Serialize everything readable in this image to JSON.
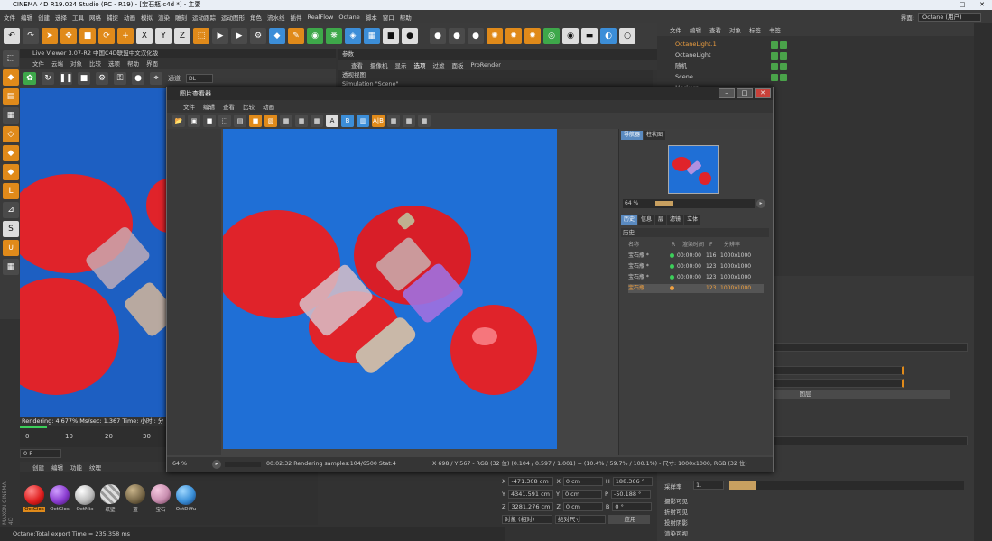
{
  "window": {
    "title": "CINEMA 4D R19.024 Studio (RC - R19) - [宝石瓶.c4d *] - 主要"
  },
  "menu": {
    "items": [
      "文件",
      "编辑",
      "创建",
      "选择",
      "工具",
      "网格",
      "捕捉",
      "动画",
      "模拟",
      "渲染",
      "雕刻",
      "运动跟踪",
      "运动图形",
      "角色",
      "流水线",
      "插件",
      "RealFlow",
      "Octane",
      "脚本",
      "窗口",
      "帮助"
    ],
    "layout_label": "界面:",
    "layout_value": "Octane (用户)"
  },
  "viewer": {
    "title": "Live Viewer 3.07-R2 中国C4D联盟中文汉化版",
    "menu": [
      "文件",
      "云端",
      "对象",
      "比较",
      "选项",
      "帮助",
      "界面"
    ],
    "channel_label": "通道",
    "channel_value": "DL",
    "status": "Rendering: 4.677% Ms/sec: 1.367   Time: 小时 : 分钟 : 秒/..."
  },
  "timeline": {
    "ticks": [
      "0",
      "10",
      "20",
      "30"
    ],
    "frame": "0 F"
  },
  "attr": {
    "menu": "参数",
    "tabs": [
      "查看",
      "摄像机",
      "显示",
      "选项",
      "过滤",
      "面板",
      "ProRender"
    ],
    "active_tab": "选项",
    "sub1": "透视视图",
    "sub2": "Simulation \"Scene\""
  },
  "objects": {
    "menu": [
      "文件",
      "编辑",
      "查看",
      "对象",
      "标签",
      "书签"
    ],
    "rows": [
      {
        "name": "OctaneLight.1",
        "highlight": true
      },
      {
        "name": "OctaneLight",
        "highlight": false
      },
      {
        "name": "随机",
        "highlight": false
      },
      {
        "name": "Scene",
        "highlight": false
      },
      {
        "name": "Markers",
        "highlight": false
      }
    ]
  },
  "materials": {
    "menu": [
      "创建",
      "编辑",
      "功能",
      "纹理"
    ],
    "items": [
      {
        "name": "OctGlos",
        "color": "#e02020"
      },
      {
        "name": "OctGlos",
        "color": "#8a3cd0"
      },
      {
        "name": "OctMix",
        "color": "#d8d8d8"
      },
      {
        "name": "纸壁",
        "color": "#c8c8c8"
      },
      {
        "name": "蓝",
        "color": "#7a6a4a"
      },
      {
        "name": "宝石",
        "color": "#c98fb0"
      },
      {
        "name": "OctDiffu",
        "color": "#3a8fd8"
      }
    ]
  },
  "statusline": "Octane:Total export Time = 235.358 ms",
  "coords": {
    "rows": [
      [
        "X",
        "-471.308 cm",
        "X",
        "0 cm",
        "H",
        "188.366 °"
      ],
      [
        "Y",
        "4341.591 cm",
        "Y",
        "0 cm",
        "P",
        "-50.188 °"
      ],
      [
        "Z",
        "3281.276 cm",
        "Z",
        "0 cm",
        "B",
        "0 °"
      ]
    ],
    "mode1": "对象 (相对)",
    "mode2": "绝对尺寸",
    "apply": "应用"
  },
  "props": {
    "label_sample": "采样率",
    "sample_value": "1.",
    "button": "图层",
    "checks": [
      "摄影可见",
      "折射可见",
      "投射阴影",
      "渲染可视"
    ]
  },
  "piv": {
    "title": "图片查看器",
    "menu": [
      "文件",
      "编辑",
      "查看",
      "比较",
      "动画"
    ],
    "nav_tabs": [
      "导航器",
      "柱状图"
    ],
    "zoom": "64 %",
    "hist_tabs": [
      "历史",
      "信息",
      "层",
      "滤镜",
      "立体"
    ],
    "hist_label": "历史",
    "hist_header": [
      "名称",
      "R",
      "渲染时间",
      "F",
      "分辨率"
    ],
    "hist_rows": [
      [
        "宝石瓶 *",
        "00:00:00",
        "116",
        "1000x1000"
      ],
      [
        "宝石瓶 *",
        "00:00:00",
        "123",
        "1000x1000"
      ],
      [
        "宝石瓶 *",
        "00:00:00",
        "123",
        "1000x1000"
      ],
      [
        "宝石瓶",
        "",
        "123",
        "1000x1000"
      ]
    ],
    "status_zoom": "64 %",
    "status_time": "00:02:32 Rendering samples:104/6500 Stat:4",
    "status_info": "X 698 / Y 567 - RGB (32 位) (0.104 / 0.597 / 1.001) = (10.4% / 59.7% / 100.1%) - 尺寸: 1000x1000, RGB (32 位)"
  },
  "colors": {
    "accent": "#e08a1a",
    "bg": "#323232",
    "blue": "#1f6fd6"
  }
}
